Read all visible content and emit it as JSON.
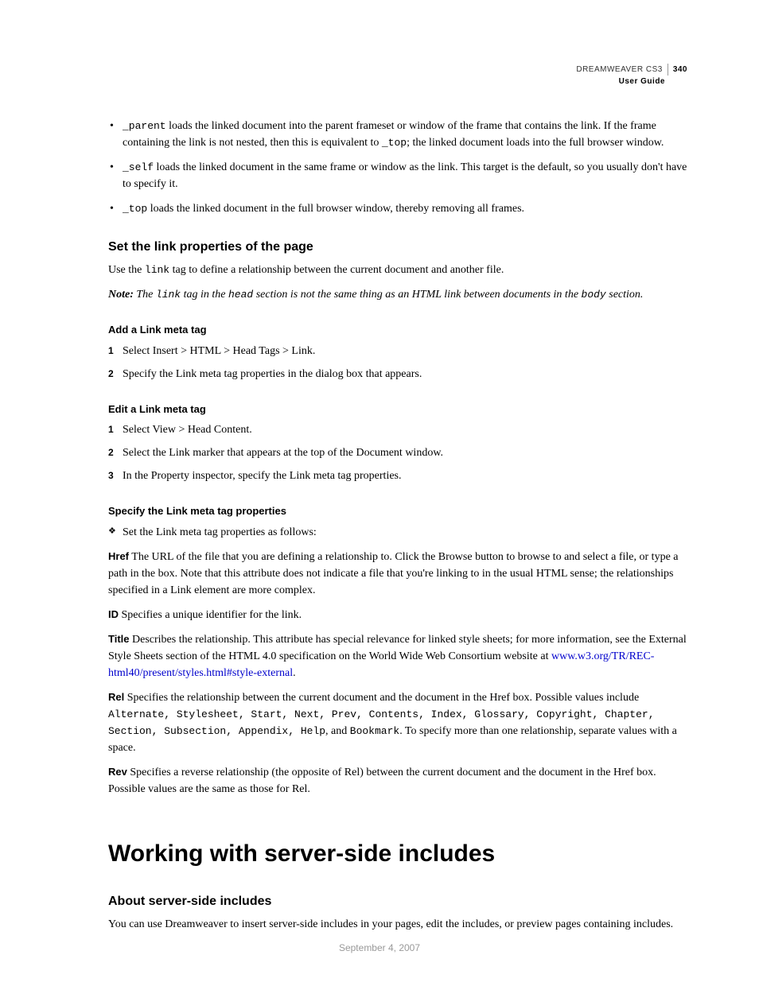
{
  "header": {
    "product": "DREAMWEAVER CS3",
    "page_number": "340",
    "guide": "User Guide"
  },
  "bullets": [
    {
      "code": "_parent",
      "text_after": " loads the linked document into the parent frameset or window of the frame that contains the link. If the frame containing the link is not nested, then this is equivalent to ",
      "code2": "_top",
      "text_after2": "; the linked document loads into the full browser window."
    },
    {
      "code": "_self",
      "text_after": " loads the linked document in the same frame or window as the link. This target is the default, so you usually don't have to specify it."
    },
    {
      "code": "_top",
      "text_after": " loads the linked document in the full browser window, thereby removing all frames."
    }
  ],
  "section1": {
    "title": "Set the link properties of the page",
    "intro_before": "Use the ",
    "intro_code": "link",
    "intro_after": " tag to define a relationship between the current document and another file.",
    "note_label": "Note:",
    "note_before": " The ",
    "note_code1": "link",
    "note_mid1": " tag in the ",
    "note_code2": "head",
    "note_mid2": " section is not the same thing as an HTML link between documents in the ",
    "note_code3": "body",
    "note_after": " section."
  },
  "add_tag": {
    "title": "Add a Link meta tag",
    "steps": [
      "Select Insert > HTML > Head Tags > Link.",
      "Specify the Link meta tag properties in the dialog box that appears."
    ]
  },
  "edit_tag": {
    "title": "Edit a Link meta tag",
    "steps": [
      "Select View > Head Content.",
      "Select the Link marker that appears at the top of the Document window.",
      "In the Property inspector, specify the Link meta tag properties."
    ]
  },
  "specify": {
    "title": "Specify the Link meta tag properties",
    "lead": "Set the Link meta tag properties as follows:",
    "href": {
      "label": "Href",
      "text": "  The URL of the file that you are defining a relationship to. Click the Browse button to browse to and select a file, or type a path in the box. Note that this attribute does not indicate a file that you're linking to in the usual HTML sense; the relationships specified in a Link element are more complex."
    },
    "id": {
      "label": "ID",
      "text": "  Specifies a unique identifier for the link."
    },
    "title_def": {
      "label": "Title",
      "text_before": "  Describes the relationship. This attribute has special relevance for linked style sheets; for more information, see the External Style Sheets section of the HTML 4.0 specification on the World Wide Web Consortium website at ",
      "link_text": "www.w3.org/TR/REC-html40/present/styles.html#style-external",
      "text_after": "."
    },
    "rel": {
      "label": "Rel",
      "text_before": "  Specifies the relationship between the current document and the document in the Href box. Possible values include ",
      "codes": "Alternate, Stylesheet, Start, Next, Prev, Contents, Index, Glossary, Copyright, Chapter, Section, Subsection, Appendix, Help",
      "text_mid": ", and ",
      "code_last": "Bookmark",
      "text_after": ". To specify more than one relationship, separate values with a space."
    },
    "rev": {
      "label": "Rev",
      "text": "  Specifies a reverse relationship (the opposite of Rel) between the current document and the document in the Href box. Possible values are the same as those for Rel."
    }
  },
  "h1": "Working with server-side includes",
  "about": {
    "title": "About server-side includes",
    "text": "You can use Dreamweaver to insert server-side includes in your pages, edit the includes, or preview pages containing includes."
  },
  "footer_date": "September 4, 2007"
}
